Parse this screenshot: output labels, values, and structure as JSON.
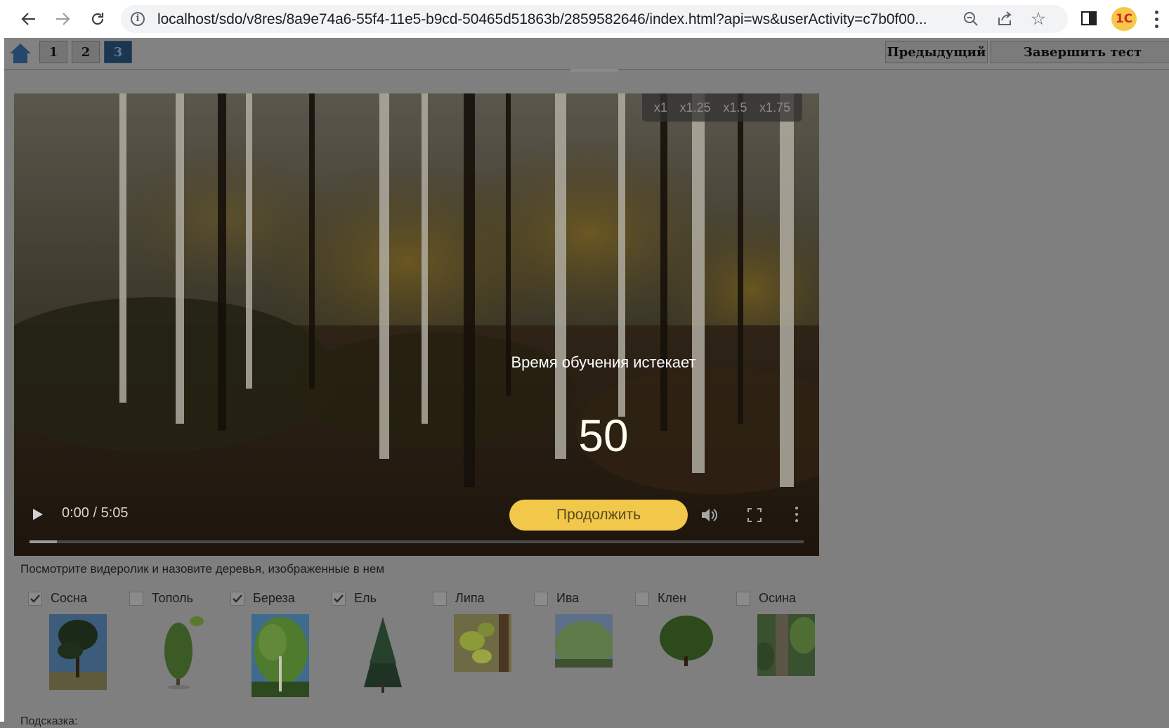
{
  "browser": {
    "url": "localhost/sdo/v8res/8a9e74a6-55f4-11e5-b9cd-50465d51863b/2859582646/index.html?api=ws&userActivity=c7b0f00...",
    "extension_label": "1С"
  },
  "toolbar": {
    "questions": [
      "1",
      "2",
      "3"
    ],
    "active_question": "3",
    "prev_label": "Предыдущий",
    "finish_label": "Завершить тест"
  },
  "video": {
    "speeds": [
      "x1",
      "x1.25",
      "x1.5",
      "x1.75"
    ],
    "timeout_title": "Время обучения истекает",
    "countdown": "50",
    "continue_label": "Продолжить",
    "time": "0:00 / 5:05",
    "progress_fraction": 0.035
  },
  "question": {
    "text": "Посмотрите видеролик и назовите деревья, изображенные в нем",
    "options": [
      {
        "label": "Сосна",
        "checked": true,
        "image": "pine-tree"
      },
      {
        "label": "Тополь",
        "checked": false,
        "image": "poplar-tree"
      },
      {
        "label": "Береза",
        "checked": true,
        "image": "birch-tree"
      },
      {
        "label": "Ель",
        "checked": true,
        "image": "spruce-tree"
      },
      {
        "label": "Липа",
        "checked": false,
        "image": "linden-leaves"
      },
      {
        "label": "Ива",
        "checked": false,
        "image": "willow-tree"
      },
      {
        "label": "Клен",
        "checked": false,
        "image": "maple-tree"
      },
      {
        "label": "Осина",
        "checked": false,
        "image": "aspen-tree"
      }
    ],
    "hint_label": "Подсказка:"
  },
  "colors": {
    "overlay_gray": "#7f7f7f",
    "active_question": "#1b3650",
    "continue_button": "#f1c84a"
  }
}
